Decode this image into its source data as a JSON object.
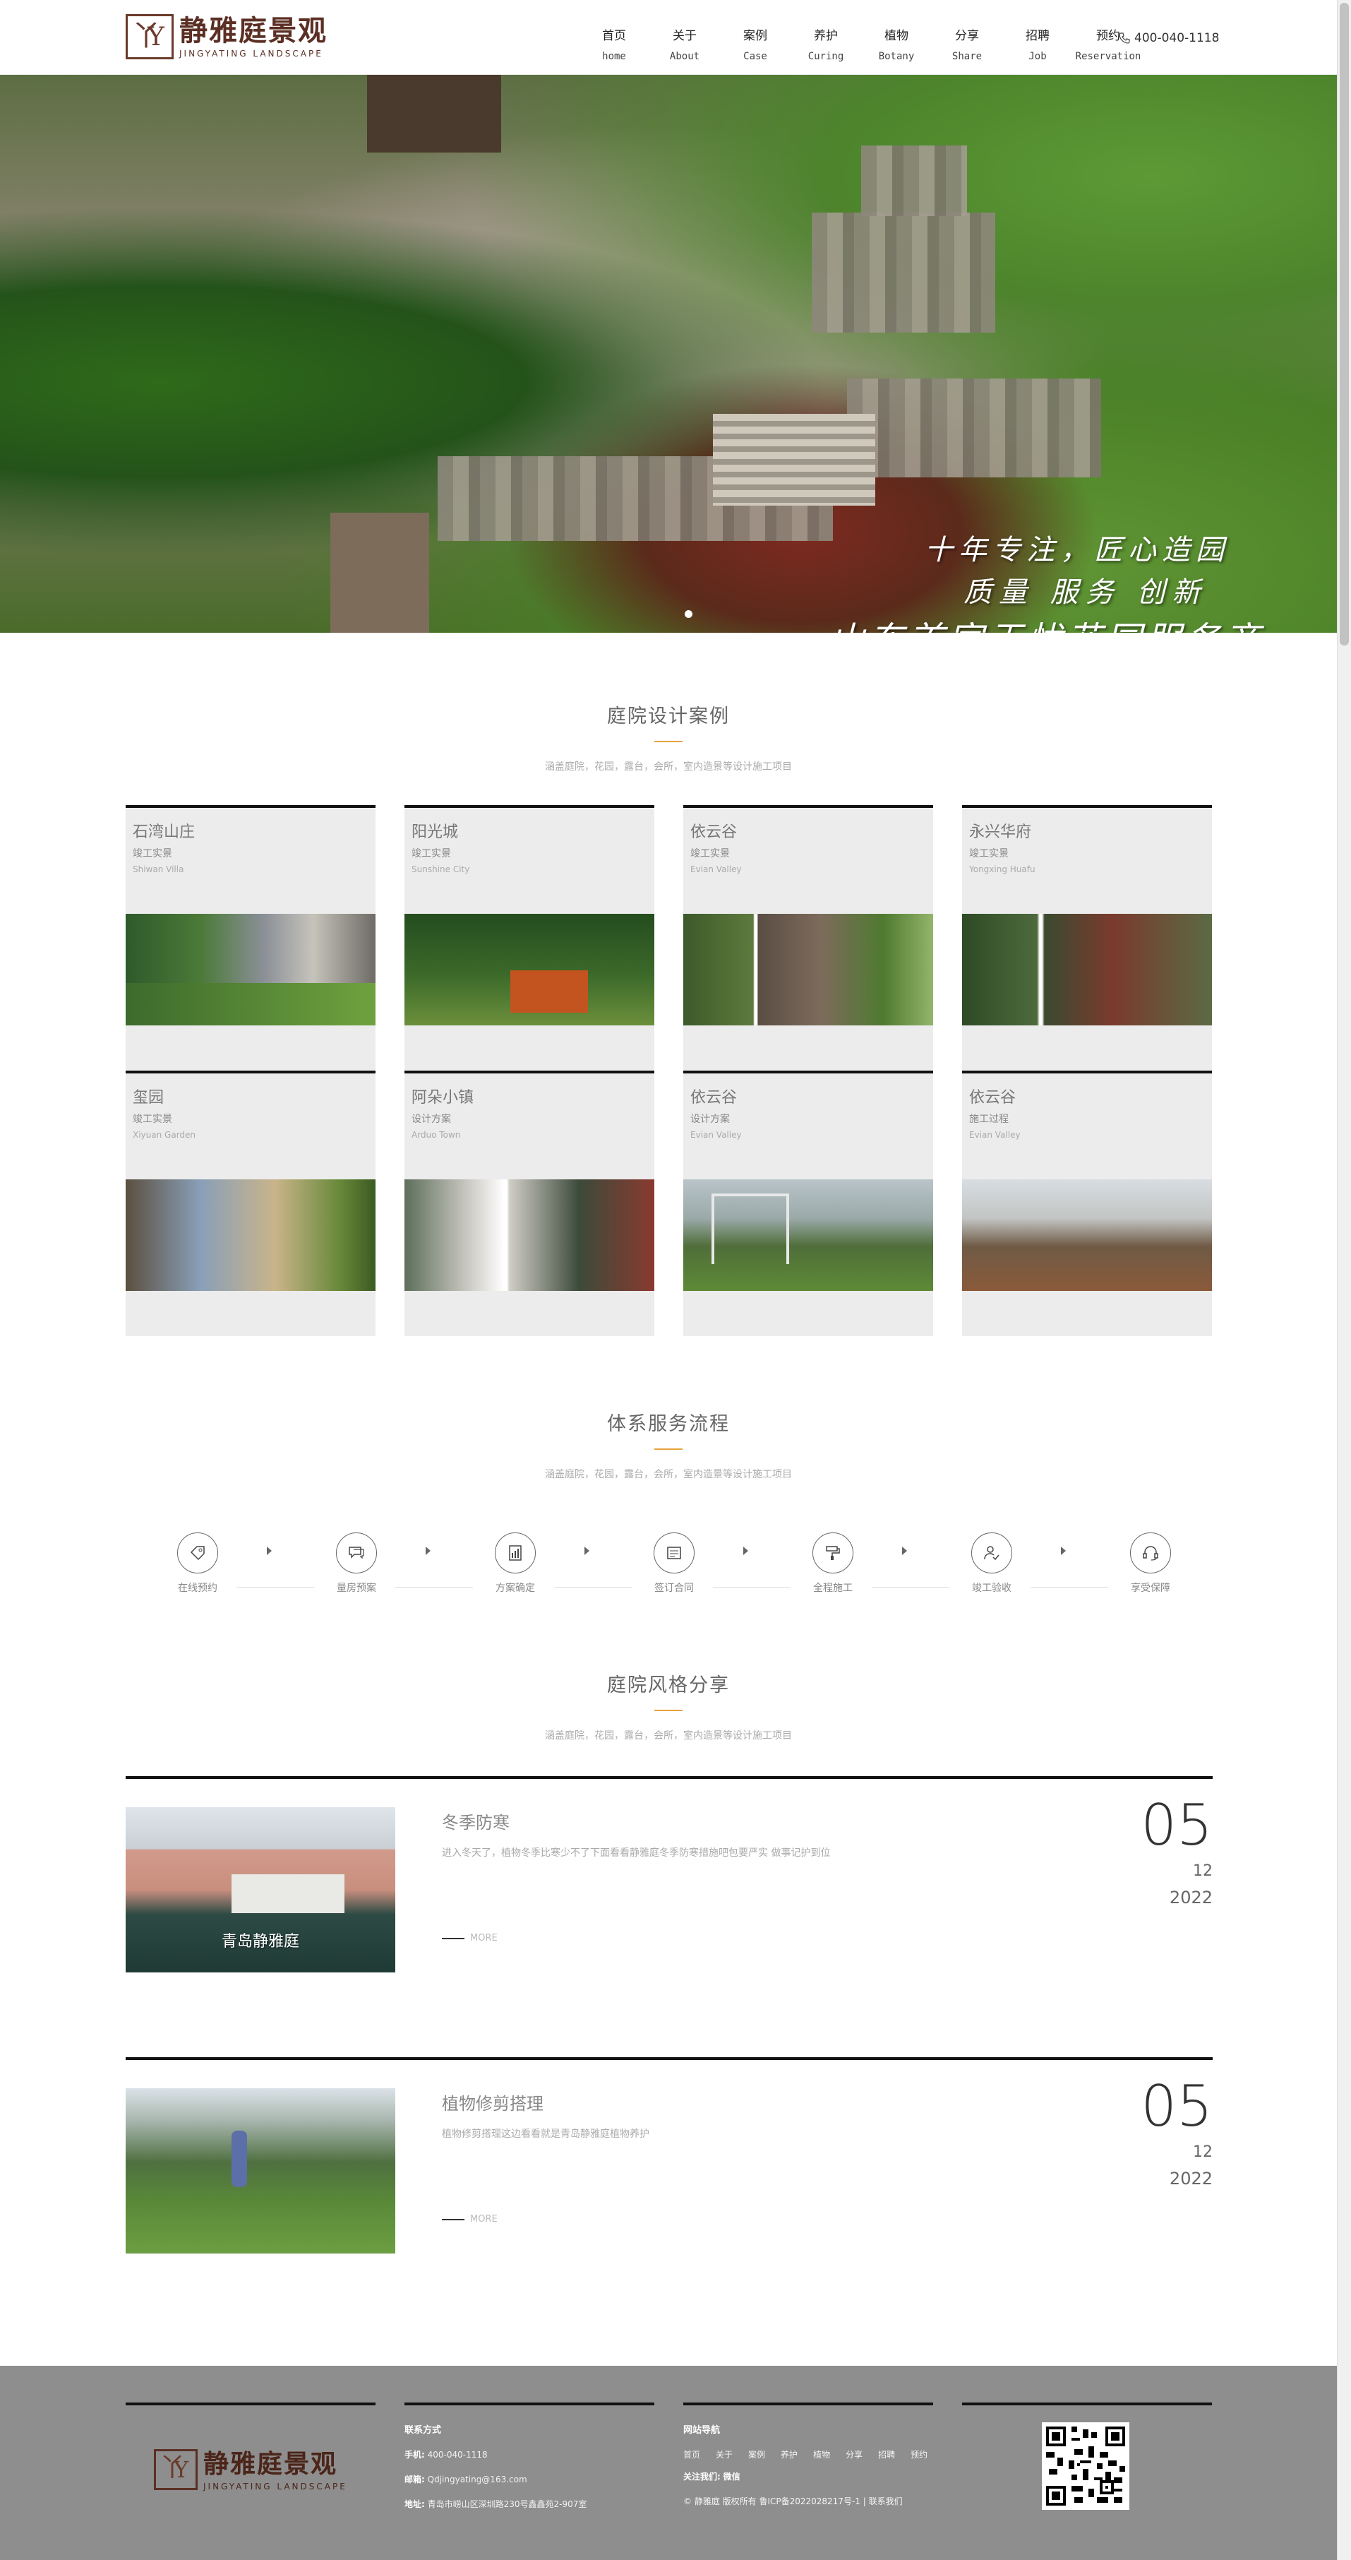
{
  "header": {
    "logo_cn": "静雅庭景观",
    "logo_en": "JINGYATING LANDSCAPE",
    "nav": [
      {
        "cn": "首页",
        "en": "home"
      },
      {
        "cn": "关于",
        "en": "About"
      },
      {
        "cn": "案例",
        "en": "Case"
      },
      {
        "cn": "养护",
        "en": "Curing"
      },
      {
        "cn": "植物",
        "en": "Botany"
      },
      {
        "cn": "分享",
        "en": "Share"
      },
      {
        "cn": "招聘",
        "en": "Job"
      },
      {
        "cn": "预约",
        "en": "Reservation"
      }
    ],
    "phone": "400-040-1118"
  },
  "banner": {
    "line1": "十年专注，匠心造园",
    "line2": "质量 服务 创新",
    "line3": "山东首家无忧花园服务商"
  },
  "cases": {
    "title": "庭院设计案例",
    "subtitle": "涵盖庭院，花园，露台，会所，室内造景等设计施工项目",
    "items": [
      {
        "name": "石湾山庄",
        "status": "竣工实景",
        "en": "Shiwan Villa"
      },
      {
        "name": "阳光城",
        "status": "竣工实景",
        "en": "Sunshine City"
      },
      {
        "name": "依云谷",
        "status": "竣工实景",
        "en": "Evian Valley"
      },
      {
        "name": "永兴华府",
        "status": "竣工实景",
        "en": "Yongxing Huafu"
      },
      {
        "name": "玺园",
        "status": "竣工实景",
        "en": "Xiyuan Garden"
      },
      {
        "name": "阿朵小镇",
        "status": "设计方案",
        "en": "Arduo Town"
      },
      {
        "name": "依云谷",
        "status": "设计方案",
        "en": "Evian Valley"
      },
      {
        "name": "依云谷",
        "status": "施工过程",
        "en": "Evian Valley"
      }
    ]
  },
  "flow": {
    "title": "体系服务流程",
    "subtitle": "涵盖庭院，花园，露台，会所，室内造景等设计施工项目",
    "steps": [
      "在线预约",
      "量房预案",
      "方案确定",
      "签订合同",
      "全程施工",
      "竣工验收",
      "享受保障"
    ]
  },
  "share": {
    "title": "庭院风格分享",
    "subtitle": "涵盖庭院，花园，露台，会所，室内造景等设计施工项目",
    "articles": [
      {
        "title": "冬季防寒",
        "desc": "进入冬天了，植物冬季比寒少不了下面看看静雅庭冬季防寒措施吧包要严实 做事记护到位",
        "more": "MORE",
        "day": "05",
        "month": "12",
        "year": "2022",
        "caption": "青岛静雅庭"
      },
      {
        "title": "植物修剪搭理",
        "desc": "植物修剪搭理这边看看就是青岛静雅庭植物养护",
        "more": "MORE",
        "day": "05",
        "month": "12",
        "year": "2022",
        "caption": ""
      }
    ]
  },
  "footer": {
    "contact_title": "联系方式",
    "phone_label": "手机:",
    "phone": "400-040-1118",
    "email_label": "邮箱:",
    "email": "Qdjingyating@163.com",
    "addr_label": "地址:",
    "addr": "青岛市崂山区深圳路230号鑫鑫苑2-907室",
    "nav_title": "网站导航",
    "links": [
      "首页",
      "关于",
      "案例",
      "养护",
      "植物",
      "分享",
      "招聘",
      "预约"
    ],
    "follow_label": "关注我们:",
    "follow_value": "微信",
    "copyright": "© 静雅庭 版权所有 鲁ICP备2022028217号-1 | 联系我们"
  },
  "colors": {
    "accent": "#e6a23c",
    "footer_bg": "#8e8e8e",
    "brand": "#5b2f24"
  }
}
